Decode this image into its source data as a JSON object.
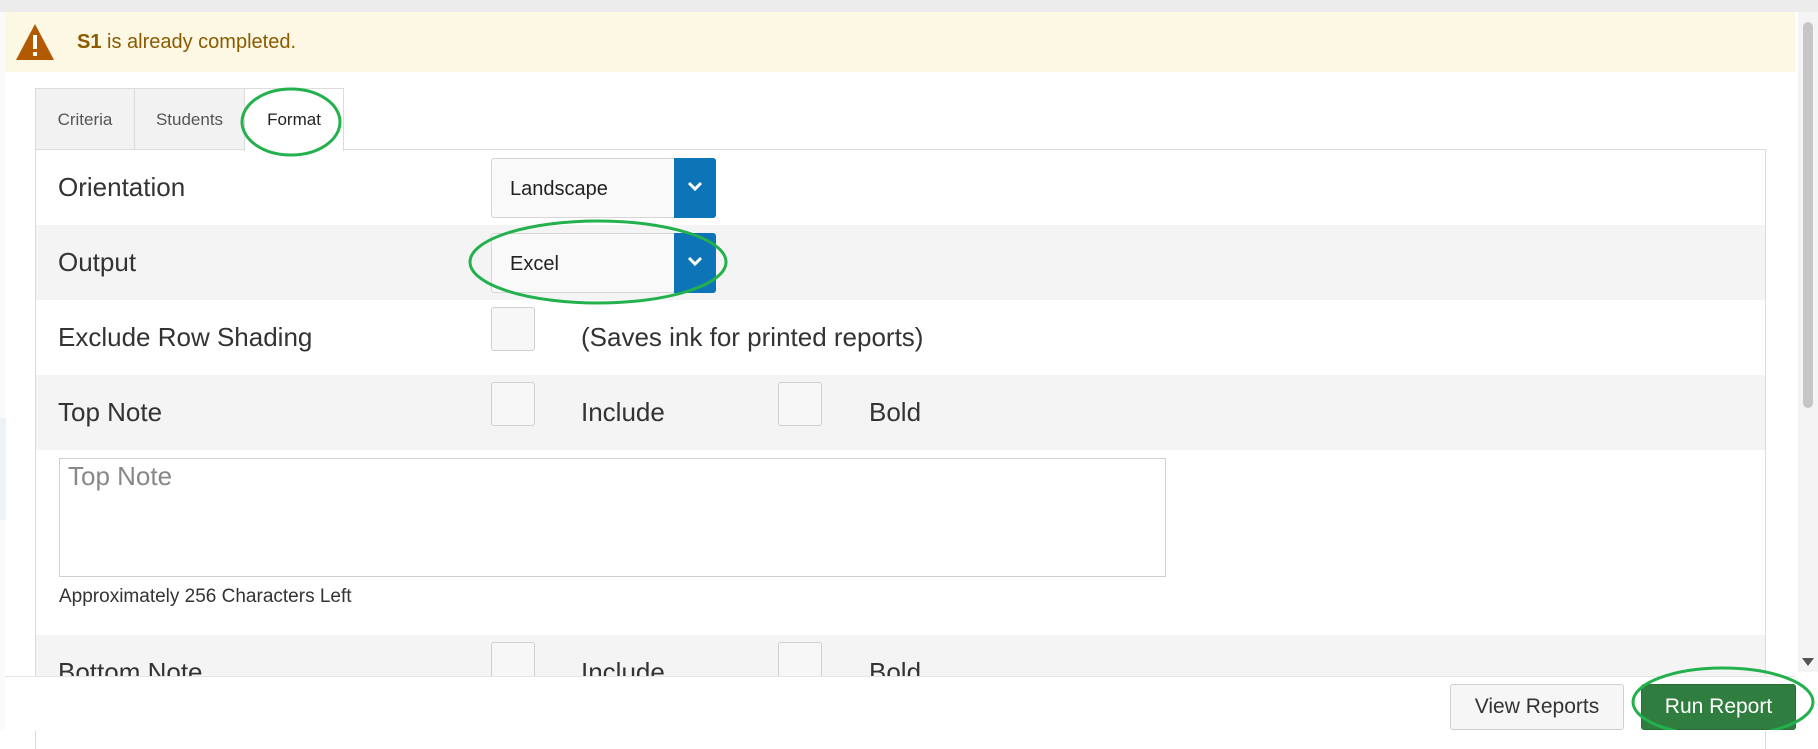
{
  "alert": {
    "code": "S1",
    "message": " is already completed."
  },
  "tabs": [
    {
      "label": "Criteria"
    },
    {
      "label": "Students"
    },
    {
      "label": "Format"
    }
  ],
  "format": {
    "orientation": {
      "label": "Orientation",
      "value": "Landscape"
    },
    "output": {
      "label": "Output",
      "value": "Excel"
    },
    "exclude_row_shading": {
      "label": "Exclude Row Shading",
      "hint": "(Saves ink for printed reports)"
    },
    "top_note": {
      "label": "Top Note",
      "include_label": "Include",
      "bold_label": "Bold",
      "placeholder": "Top Note",
      "chars_left": "Approximately 256 Characters Left"
    },
    "bottom_note": {
      "label": "Bottom Note",
      "include_label": "Include",
      "bold_label": "Bold"
    }
  },
  "buttons": {
    "view_reports": "View Reports",
    "run_report": "Run Report"
  },
  "colors": {
    "accent_blue": "#0e74b8",
    "run_green": "#2f7d3f",
    "annotation_green": "#22b14c",
    "alert_bg": "#fcf8e3"
  }
}
